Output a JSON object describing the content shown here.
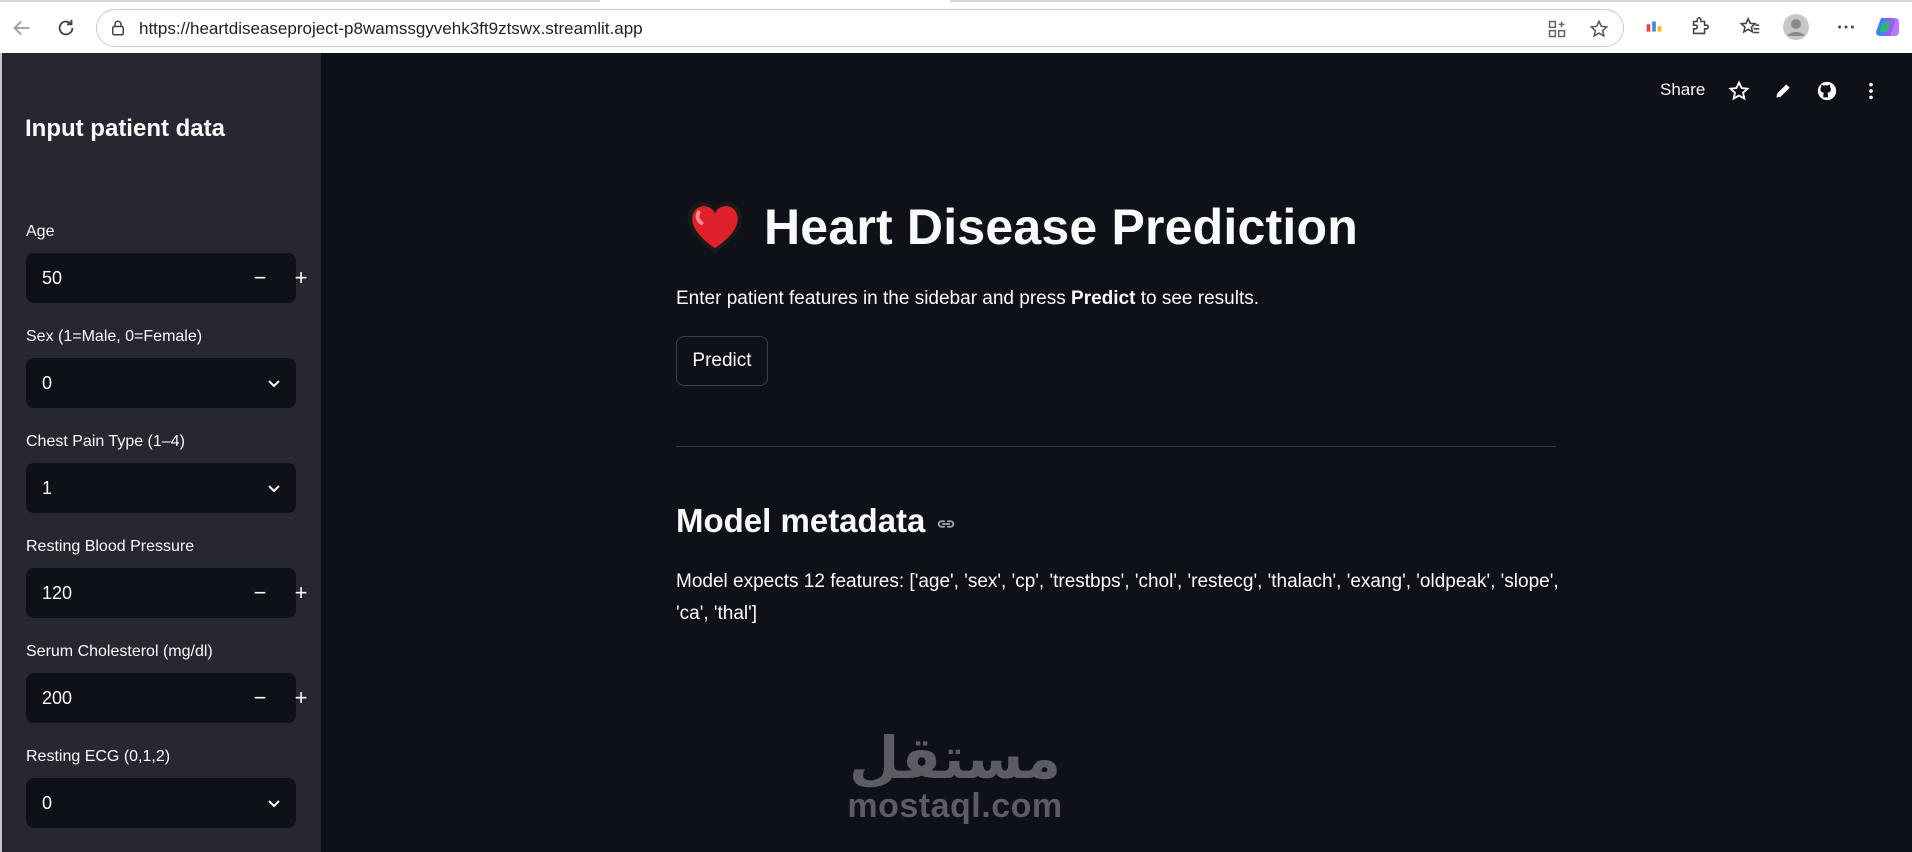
{
  "browser": {
    "url": "https://heartdiseaseproject-p8wamssgyvehk3ft9ztswx.streamlit.app"
  },
  "toolbar": {
    "share_label": "Share"
  },
  "sidebar": {
    "title": "Input patient data",
    "fields": [
      {
        "label": "Age",
        "value": "50",
        "type": "number"
      },
      {
        "label": "Sex (1=Male, 0=Female)",
        "value": "0",
        "type": "select"
      },
      {
        "label": "Chest Pain Type (1–4)",
        "value": "1",
        "type": "select"
      },
      {
        "label": "Resting Blood Pressure",
        "value": "120",
        "type": "number"
      },
      {
        "label": "Serum Cholesterol (mg/dl)",
        "value": "200",
        "type": "number"
      },
      {
        "label": "Resting ECG (0,1,2)",
        "value": "0",
        "type": "select"
      }
    ]
  },
  "main": {
    "title": "Heart Disease Prediction",
    "lead_before": "Enter patient features in the sidebar and press ",
    "lead_bold": "Predict",
    "lead_after": " to see results.",
    "predict_label": "Predict",
    "metadata_heading": "Model metadata",
    "metadata_text": "Model expects 12 features: ['age', 'sex', 'cp', 'trestbps', 'chol', 'restecg', 'thalach', 'exang', 'oldpeak', 'slope', 'ca', 'thal']"
  },
  "watermark": {
    "arabic": "مستقل",
    "latin": "mostaql.com"
  },
  "colors": {
    "background": "#0e1117",
    "sidebar": "#262730",
    "text": "#fafafa",
    "heart": "#e0202b"
  }
}
